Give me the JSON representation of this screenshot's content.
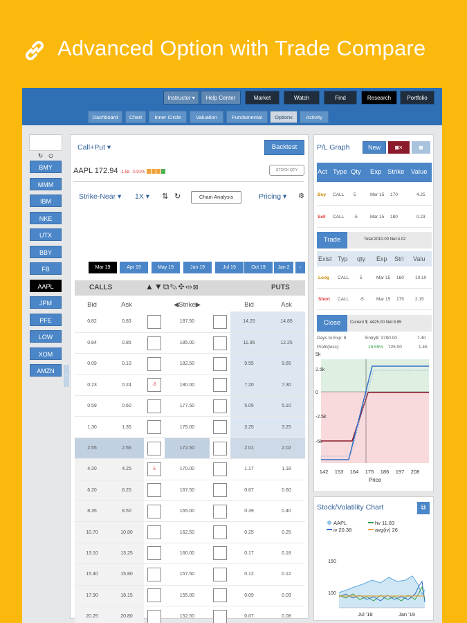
{
  "header": {
    "title": "Advanced Option with Trade Compare"
  },
  "topbar": {
    "instructor": "Instructor",
    "help_center": "Help Center",
    "market": "Market",
    "watch": "Watch",
    "find": "Find",
    "research": "Research",
    "portfolio": "Portfolio"
  },
  "tabs": [
    {
      "label": "Dashboard"
    },
    {
      "label": "Chart"
    },
    {
      "label": "Inner Circle"
    },
    {
      "label": "Valuation"
    },
    {
      "label": "Fundamental"
    },
    {
      "label": "Options"
    },
    {
      "label": "Activity"
    }
  ],
  "sidebar": {
    "tickers": [
      "BMY",
      "MMM",
      "IBM",
      "NKE",
      "UTX",
      "BBY",
      "FB",
      "AAPL",
      "JPM",
      "PFE",
      "LOW",
      "XOM",
      "AMZN"
    ],
    "active": "AAPL"
  },
  "options": {
    "strategy": "Call+Put",
    "backtest": "Backtest",
    "symbol": "AAPL",
    "price": "172.94",
    "change": "-1.58",
    "change_pct": "-0.91%",
    "stock_qty": "STOCK QTY",
    "strike_mode": "Strike-Near",
    "multiplier": "1X",
    "chain_analysis": "Chain Analysis",
    "pricing": "Pricing",
    "expirations": [
      "Mar 19",
      "Apr 19",
      "May 19",
      "Jun 19",
      "Jul 19",
      "Oct 19",
      "Jan 2"
    ],
    "active_expiration": "Mar 19",
    "calls_label": "CALLS",
    "puts_label": "PUTS",
    "col_bid": "Bid",
    "col_ask": "Ask",
    "col_strike": "Strike",
    "rows": [
      {
        "cbid": "0.82",
        "cask": "0.83",
        "strike": "187.50",
        "pbid": "14.25",
        "pask": "14.85",
        "cmark": "",
        "pmark": ""
      },
      {
        "cbid": "0.84",
        "cask": "0.85",
        "strike": "185.00",
        "pbid": "11.95",
        "pask": "12.25",
        "cmark": "",
        "pmark": ""
      },
      {
        "cbid": "0.09",
        "cask": "0.10",
        "strike": "182.50",
        "pbid": "9.55",
        "pask": "9.65",
        "cmark": "",
        "pmark": ""
      },
      {
        "cbid": "0.23",
        "cask": "0.24",
        "strike": "180.00",
        "pbid": "7.20",
        "pask": "7.30",
        "cmark": "-5",
        "pmark": ""
      },
      {
        "cbid": "0.59",
        "cask": "0.60",
        "strike": "177.50",
        "pbid": "5.05",
        "pask": "5.10",
        "cmark": "",
        "pmark": ""
      },
      {
        "cbid": "1.30",
        "cask": "1.35",
        "strike": "175.00",
        "pbid": "3.25",
        "pask": "3.25",
        "cmark": "",
        "pmark": ""
      },
      {
        "cbid": "2.55",
        "cask": "2.56",
        "strike": "172.50",
        "pbid": "2.01",
        "pask": "2.02",
        "cmark": "",
        "pmark": ""
      },
      {
        "cbid": "4.20",
        "cask": "4.25",
        "strike": "170.00",
        "pbid": "1.17",
        "pask": "1.18",
        "cmark": "5",
        "pmark": ""
      },
      {
        "cbid": "6.20",
        "cask": "6.25",
        "strike": "167.50",
        "pbid": "0.67",
        "pask": "0.60",
        "cmark": "",
        "pmark": ""
      },
      {
        "cbid": "8.35",
        "cask": "8.50",
        "strike": "165.00",
        "pbid": "0.39",
        "pask": "0.40",
        "cmark": "",
        "pmark": ""
      },
      {
        "cbid": "10.70",
        "cask": "10.80",
        "strike": "162.50",
        "pbid": "0.25",
        "pask": "0.25",
        "cmark": "",
        "pmark": ""
      },
      {
        "cbid": "13.10",
        "cask": "13.25",
        "strike": "160.00",
        "pbid": "0.17",
        "pask": "0.18",
        "cmark": "",
        "pmark": ""
      },
      {
        "cbid": "15.40",
        "cask": "15.80",
        "strike": "157.50",
        "pbid": "0.12",
        "pask": "0.12",
        "cmark": "",
        "pmark": ""
      },
      {
        "cbid": "17.90",
        "cask": "18.15",
        "strike": "155.00",
        "pbid": "0.09",
        "pask": "0.09",
        "cmark": "",
        "pmark": ""
      },
      {
        "cbid": "20.25",
        "cask": "20.80",
        "strike": "152.50",
        "pbid": "0.07",
        "pask": "0.08",
        "cmark": "",
        "pmark": ""
      },
      {
        "cbid": "22.90",
        "cask": "23.25",
        "strike": "150.00",
        "pbid": "0.05",
        "pask": "0.05",
        "cmark": "",
        "pmark": ""
      }
    ]
  },
  "pl": {
    "title": "P/L Graph",
    "new": "New",
    "trade_head": {
      "act": "Act",
      "type": "Type",
      "qty": "Qty",
      "exp": "Exp",
      "strike": "Strike",
      "value": "Value"
    },
    "trade_rows": [
      {
        "act": "Buy",
        "type": "CALL",
        "qty": "5",
        "exp": "Mar 15",
        "strike": "170",
        "value": "4.25"
      },
      {
        "act": "Sell",
        "type": "CALL",
        "qty": "-5",
        "exp": "Mar 15",
        "strike": "180",
        "value": "0.23"
      }
    ],
    "trade_btn": "Trade",
    "trade_total": "Total:2010.00 Net:4.02",
    "exist_head": {
      "act": "Exist",
      "type": "Typ",
      "qty": "qty",
      "exp": "Exp",
      "strike": "Stri",
      "value": "Valu"
    },
    "exist_rows": [
      {
        "act": "Long",
        "type": "CALL",
        "qty": "5",
        "exp": "Mar 15",
        "strike": "160",
        "value": "10.10"
      },
      {
        "act": "Short",
        "type": "CALL",
        "qty": "-5",
        "exp": "Mar 15",
        "strike": "175",
        "value": "2.15"
      }
    ],
    "close_btn": "Close",
    "close_info": "Current $: 4425.00 Net:8.85",
    "days_to_exp": "Days to Exp: 8",
    "entry": "Entry$: 3790.00",
    "entry_val": "7.40",
    "profit_label": "Profit(loss):",
    "profit_pct": "19.59%",
    "profit_amt": "725.00",
    "profit_val": "1.45",
    "y_ticks": [
      "5k",
      "2.5k",
      "0",
      "-2.5k",
      "-5k"
    ],
    "x_ticks": [
      "142",
      "153",
      "164",
      "175",
      "186",
      "197",
      "208"
    ],
    "x_label": "Price"
  },
  "sv": {
    "title": "Stock/Volatility Chart",
    "legend": [
      "AAPL",
      "hv 11.83",
      "iv 20.38",
      "avg(iv) 26"
    ],
    "y_ticks": [
      "150",
      "100"
    ],
    "x_ticks": [
      "Jul '18",
      "Jan '19"
    ]
  }
}
